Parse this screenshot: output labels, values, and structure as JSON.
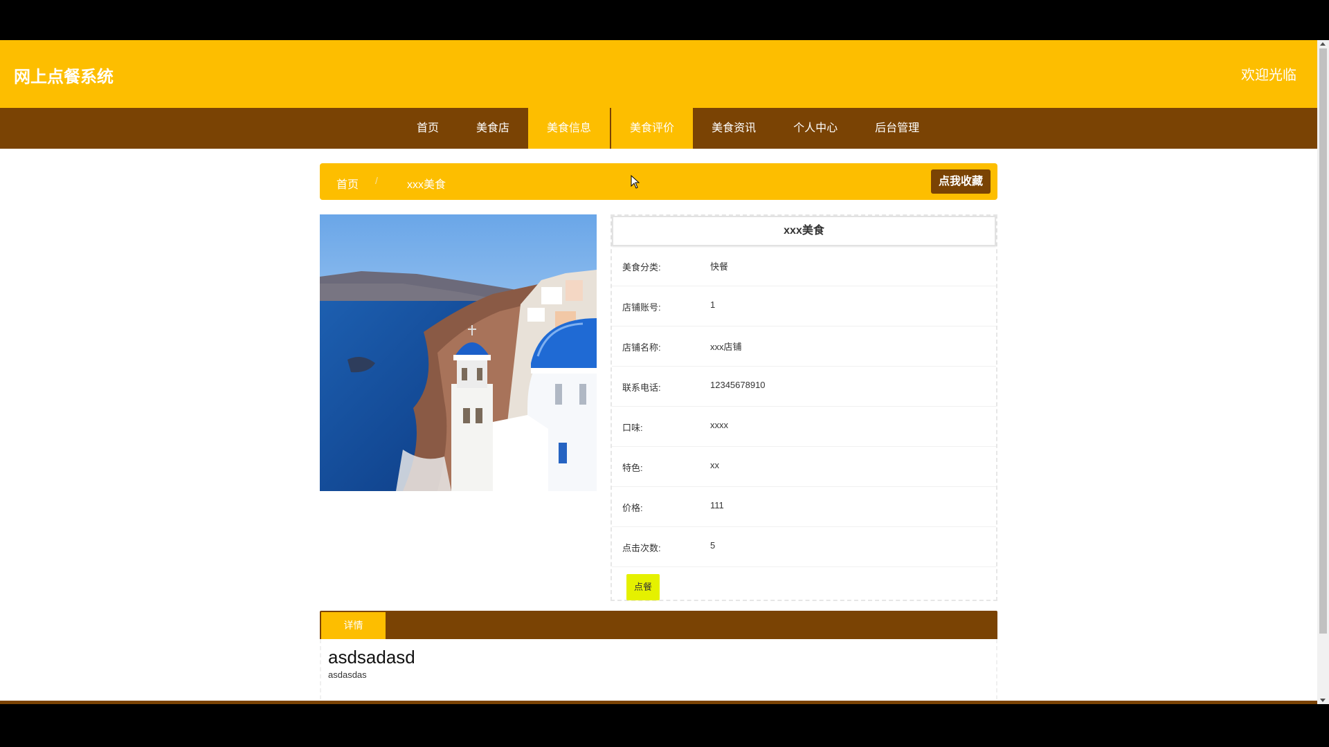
{
  "header": {
    "site_title": "网上点餐系统",
    "welcome": "欢迎光临"
  },
  "nav": {
    "items": [
      {
        "label": "首页"
      },
      {
        "label": "美食店"
      },
      {
        "label": "美食信息",
        "state": "active"
      },
      {
        "label": "美食评价",
        "state": "hover"
      },
      {
        "label": "美食资讯"
      },
      {
        "label": "个人中心"
      },
      {
        "label": "后台管理"
      }
    ]
  },
  "breadcrumb": {
    "home": "首页",
    "separator": "/",
    "current": "xxx美食",
    "favorite_button": "点我收藏"
  },
  "photo": {
    "icon": "santorini-photo",
    "alt": "food image"
  },
  "detail": {
    "title": "xxx美食",
    "fields": [
      {
        "label": "美食分类:",
        "value": "快餐"
      },
      {
        "label": "店铺账号:",
        "value": "1"
      },
      {
        "label": "店铺名称:",
        "value": "xxx店铺"
      },
      {
        "label": "联系电话:",
        "value": "12345678910"
      },
      {
        "label": "口味:",
        "value": "xxxx"
      },
      {
        "label": "特色:",
        "value": "xx"
      },
      {
        "label": "价格:",
        "value": "111"
      },
      {
        "label": "点击次数:",
        "value": "5"
      }
    ],
    "order_button": "点餐"
  },
  "tabs": {
    "detail_tab": "详情"
  },
  "content": {
    "title": "asdsadasd",
    "body": "asdasdas"
  },
  "colors": {
    "primary_yellow": "#fdbe00",
    "brown": "#7a4304",
    "order_button": "#e5f100"
  }
}
